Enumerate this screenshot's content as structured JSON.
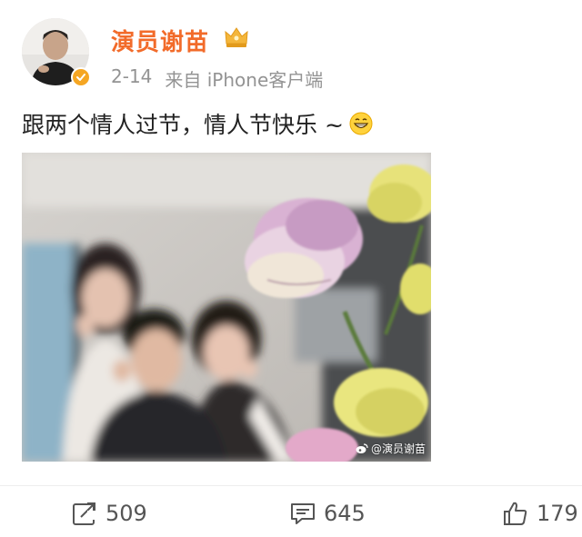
{
  "post": {
    "author": {
      "name": "演员谢苗",
      "verified_color": "#f5a623",
      "name_color": "#f26b2a",
      "avatar_icon": "avatar",
      "rank_icon": "crown-icon"
    },
    "meta": {
      "date": "2-14",
      "source": "来自 iPhone客户端"
    },
    "text": "跟两个情人过节，情人节快乐 ~",
    "emoji": "grin-emoji",
    "image": {
      "watermark": "@演员谢苗"
    },
    "actions": {
      "repost_count": "509",
      "comment_count": "645",
      "like_count": "179"
    }
  }
}
